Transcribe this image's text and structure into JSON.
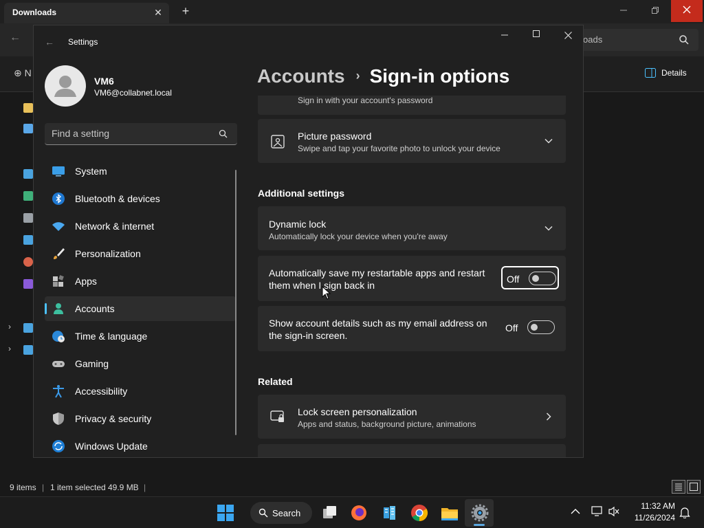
{
  "explorer": {
    "tab_title": "Downloads",
    "tab_close": "✕",
    "new_tab": "+",
    "search_text": "oads",
    "new_label": "⊕ N",
    "details_label": "Details",
    "status": {
      "items": "9 items",
      "sep1": "|",
      "selected": "1 item selected",
      "size": "49.9 MB",
      "sep2": "|"
    }
  },
  "settings": {
    "window_title": "Settings",
    "user": {
      "name": "VM6",
      "email": "VM6@collabnet.local"
    },
    "search": {
      "placeholder": "Find a setting"
    },
    "nav": [
      {
        "label": "System",
        "icon": "monitor-icon"
      },
      {
        "label": "Bluetooth & devices",
        "icon": "bluetooth-icon"
      },
      {
        "label": "Network & internet",
        "icon": "wifi-icon"
      },
      {
        "label": "Personalization",
        "icon": "brush-icon"
      },
      {
        "label": "Apps",
        "icon": "apps-icon"
      },
      {
        "label": "Accounts",
        "icon": "person-icon",
        "active": true
      },
      {
        "label": "Time & language",
        "icon": "globe-clock-icon"
      },
      {
        "label": "Gaming",
        "icon": "gamepad-icon"
      },
      {
        "label": "Accessibility",
        "icon": "accessibility-icon"
      },
      {
        "label": "Privacy & security",
        "icon": "shield-icon"
      },
      {
        "label": "Windows Update",
        "icon": "update-icon"
      }
    ],
    "breadcrumb": {
      "parent": "Accounts",
      "separator": "›",
      "current": "Sign-in options"
    },
    "password_card_sub": "Sign in with your account's password",
    "picture_password": {
      "title": "Picture password",
      "sub": "Swipe and tap your favorite photo to unlock your device"
    },
    "additional_heading": "Additional settings",
    "dynamic_lock": {
      "title": "Dynamic lock",
      "sub": "Automatically lock your device when you're away"
    },
    "restart_apps": {
      "line1": "Automatically save my restartable apps and restart",
      "line2": "them when I sign back in",
      "state": "Off"
    },
    "account_details": {
      "line1": "Show account details such as my email address on",
      "line2": "the sign-in screen.",
      "state": "Off"
    },
    "related_heading": "Related",
    "lock_screen": {
      "title": "Lock screen personalization",
      "sub": "Apps and status, background picture, animations"
    }
  },
  "taskbar": {
    "search_label": "Search",
    "time": "11:32 AM",
    "date": "11/26/2024"
  },
  "colors": {
    "accent": "#4cc2ff",
    "close_red": "#c42b1c",
    "card_bg": "#2b2b2b"
  }
}
